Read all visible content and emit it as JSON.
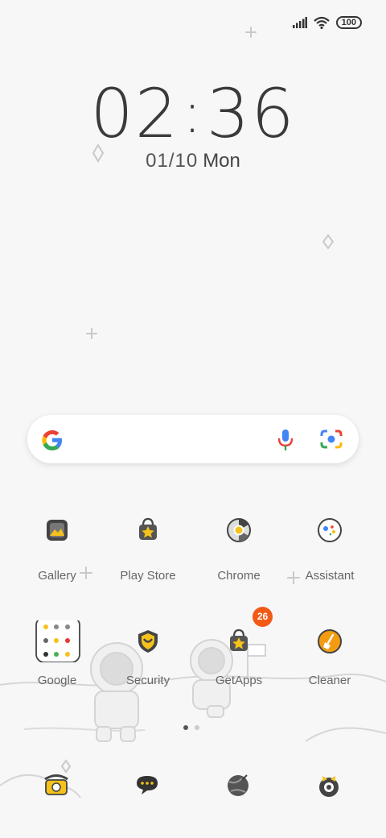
{
  "status_bar": {
    "battery": "100"
  },
  "lock": {
    "time_hour": "02",
    "time_min": "36",
    "date": "01/10",
    "day": "Mon"
  },
  "apps_row1": [
    "Gallery",
    "Play Store",
    "Chrome",
    "Assistant"
  ],
  "apps_row2": [
    "Google",
    "Security",
    "GetApps",
    "Cleaner"
  ],
  "getapps_badge": "26",
  "colors": {
    "accent_orange": "#f25a16",
    "icon_yellow": "#f5c21b"
  }
}
